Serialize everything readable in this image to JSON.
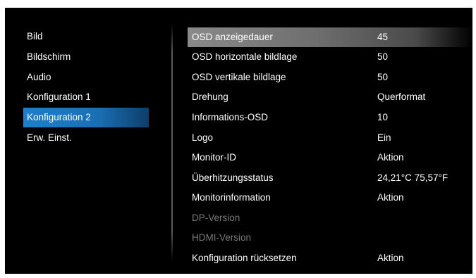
{
  "colors": {
    "background": "#000000",
    "selected_menu": "#1d7fcb",
    "highlighted_row": "#8a8a8a",
    "disabled_text": "#7a7a7a"
  },
  "left_menu": {
    "items": [
      {
        "label": "Bild",
        "selected": false
      },
      {
        "label": "Bildschirm",
        "selected": false
      },
      {
        "label": "Audio",
        "selected": false
      },
      {
        "label": "Konfiguration 1",
        "selected": false
      },
      {
        "label": "Konfiguration 2",
        "selected": true
      },
      {
        "label": "Erw. Einst.",
        "selected": false
      }
    ]
  },
  "settings": {
    "rows": [
      {
        "label": "OSD anzeigedauer",
        "value": "45",
        "highlighted": true,
        "enabled": true
      },
      {
        "label": "OSD horizontale bildlage",
        "value": "50",
        "highlighted": false,
        "enabled": true
      },
      {
        "label": "OSD vertikale bildlage",
        "value": "50",
        "highlighted": false,
        "enabled": true
      },
      {
        "label": "Drehung",
        "value": "Querformat",
        "highlighted": false,
        "enabled": true
      },
      {
        "label": "Informations-OSD",
        "value": "10",
        "highlighted": false,
        "enabled": true
      },
      {
        "label": "Logo",
        "value": "Ein",
        "highlighted": false,
        "enabled": true
      },
      {
        "label": "Monitor-ID",
        "value": "Aktion",
        "highlighted": false,
        "enabled": true
      },
      {
        "label": "Überhitzungsstatus",
        "value": "24,21°C 75,57°F",
        "highlighted": false,
        "enabled": true
      },
      {
        "label": "Monitorinformation",
        "value": "Aktion",
        "highlighted": false,
        "enabled": true
      },
      {
        "label": "DP-Version",
        "value": "",
        "highlighted": false,
        "enabled": false
      },
      {
        "label": "HDMI-Version",
        "value": "",
        "highlighted": false,
        "enabled": false
      },
      {
        "label": "Konfiguration rücksetzen",
        "value": "Aktion",
        "highlighted": false,
        "enabled": true
      }
    ]
  }
}
